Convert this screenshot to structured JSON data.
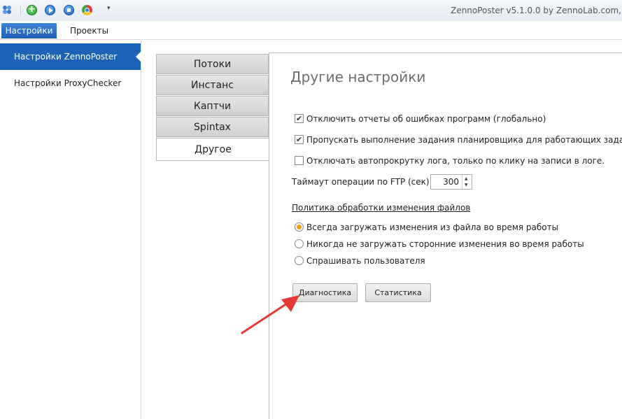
{
  "app": {
    "title": "ZennoPoster v5.1.0.0 by ZennoLab.com,"
  },
  "ribbon": {
    "tabs": [
      "Настройки",
      "Проекты"
    ]
  },
  "sidebar": {
    "items": [
      "Настройки ZennoPoster",
      "Настройки ProxyChecker"
    ]
  },
  "tabs": [
    "Потоки",
    "Инстанс",
    "Каптчи",
    "Spintax",
    "Другое"
  ],
  "panel": {
    "title": "Другие настройки",
    "checkboxes": [
      {
        "label": "Отключить отчеты об ошибках программ (глобально)",
        "checked": true
      },
      {
        "label": "Пропускать выполнение задания планировщика для работающих заданий",
        "checked": true
      },
      {
        "label": "Отключать автопрокрутку лога, только по клику на записи в логе.",
        "checked": false
      }
    ],
    "ftp_label": "Таймаут операции по FTP (сек):",
    "ftp_value": "300",
    "policy_title": "Политика обработки изменения файлов",
    "radios": [
      {
        "label": "Всегда загружать изменения из файла во время работы",
        "selected": true
      },
      {
        "label": "Никогда не загружать сторонние изменения во время работы",
        "selected": false
      },
      {
        "label": "Спрашивать пользователя",
        "selected": false
      }
    ],
    "buttons": {
      "diagnostics": "Диагностика",
      "statistics": "Статистика"
    }
  },
  "colors": {
    "accent": "#1c63b8",
    "arrow": "#e53935",
    "radio_on": "#f0a020"
  }
}
